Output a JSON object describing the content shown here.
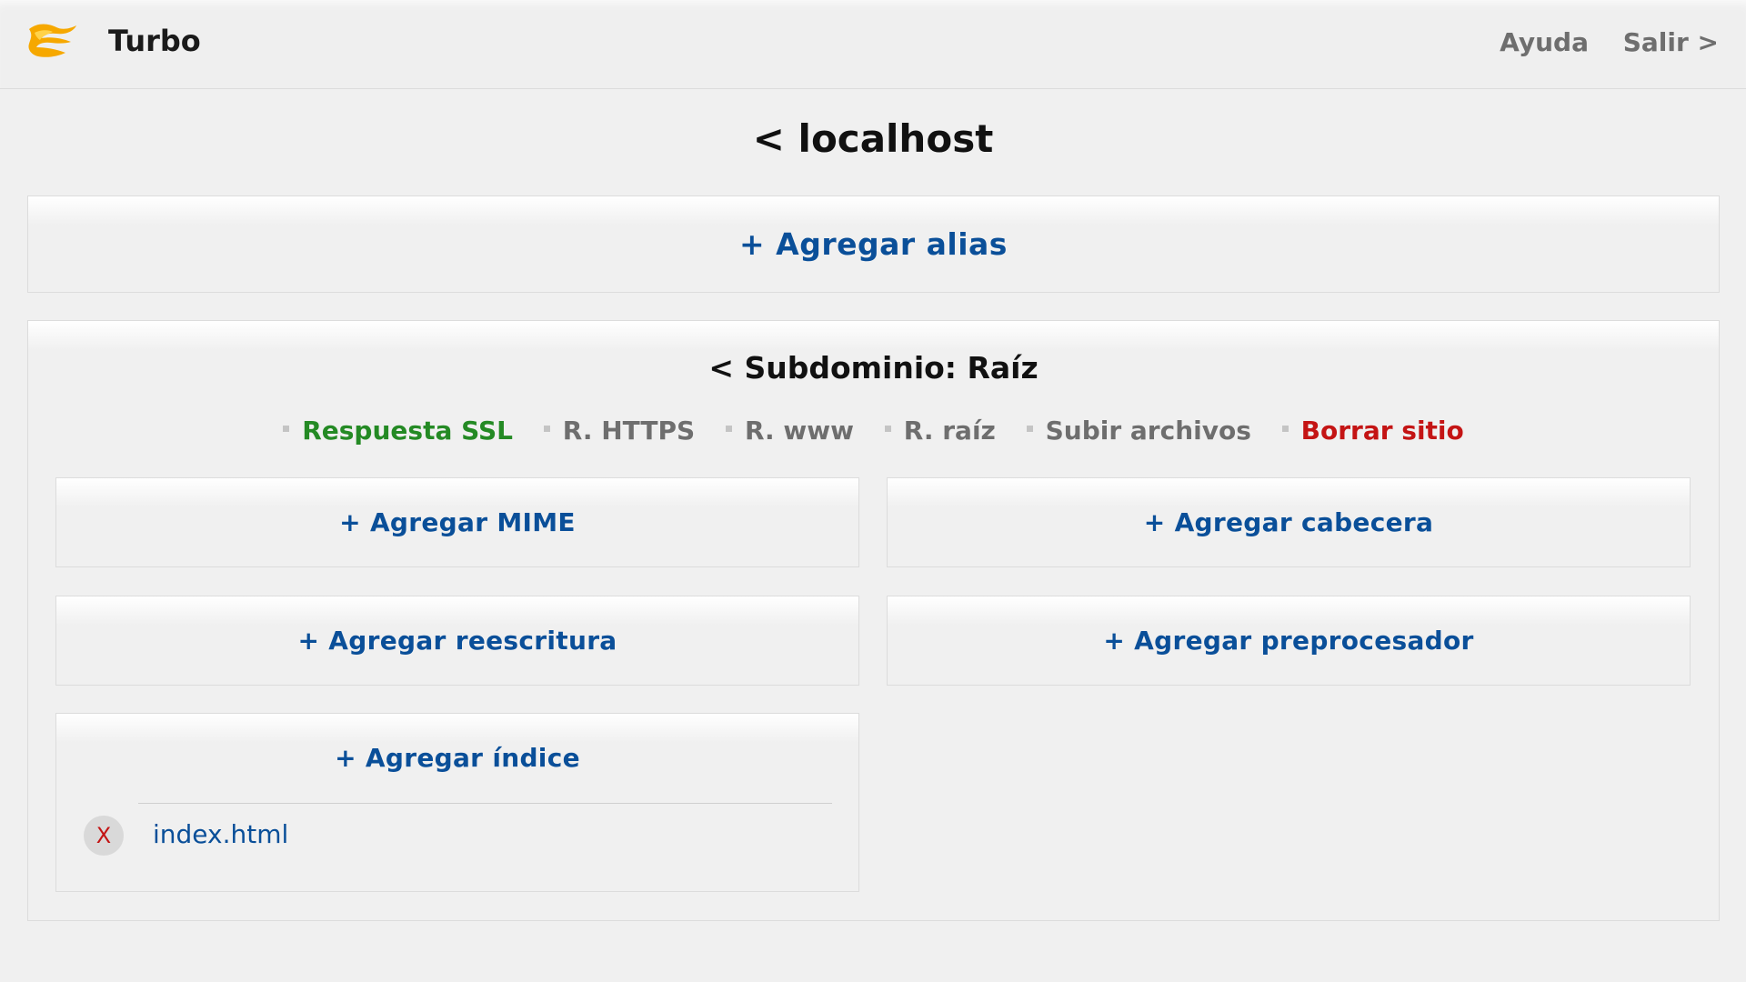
{
  "app": {
    "name": "Turbo",
    "logo_icon": "flame-logo-icon"
  },
  "nav": {
    "help": "Ayuda",
    "logout": "Salir >"
  },
  "page": {
    "title": "< localhost"
  },
  "alias": {
    "add_label": "+ Agregar alias"
  },
  "subdomain": {
    "title": "< Subdominio: Raíz",
    "links": [
      {
        "label": "Respuesta SSL",
        "color": "#248a24"
      },
      {
        "label": "R. HTTPS",
        "color": "#6e6e6e"
      },
      {
        "label": "R. www",
        "color": "#6e6e6e"
      },
      {
        "label": "R. raíz",
        "color": "#6e6e6e"
      },
      {
        "label": "Subir archivos",
        "color": "#6e6e6e"
      },
      {
        "label": "Borrar sitio",
        "color": "#c41414"
      }
    ],
    "mime": {
      "add_label": "+ Agregar MIME"
    },
    "header": {
      "add_label": "+ Agregar cabecera"
    },
    "rewrite": {
      "add_label": "+ Agregar reescritura"
    },
    "preprocessor": {
      "add_label": "+ Agregar preprocesador"
    },
    "index": {
      "add_label": "+ Agregar índice",
      "items": [
        {
          "delete_label": "X",
          "name": "index.html"
        }
      ]
    }
  },
  "colors": {
    "link_blue": "#0a4f99",
    "background": "#f0f0f0",
    "danger": "#c41414",
    "success": "#248a24"
  }
}
